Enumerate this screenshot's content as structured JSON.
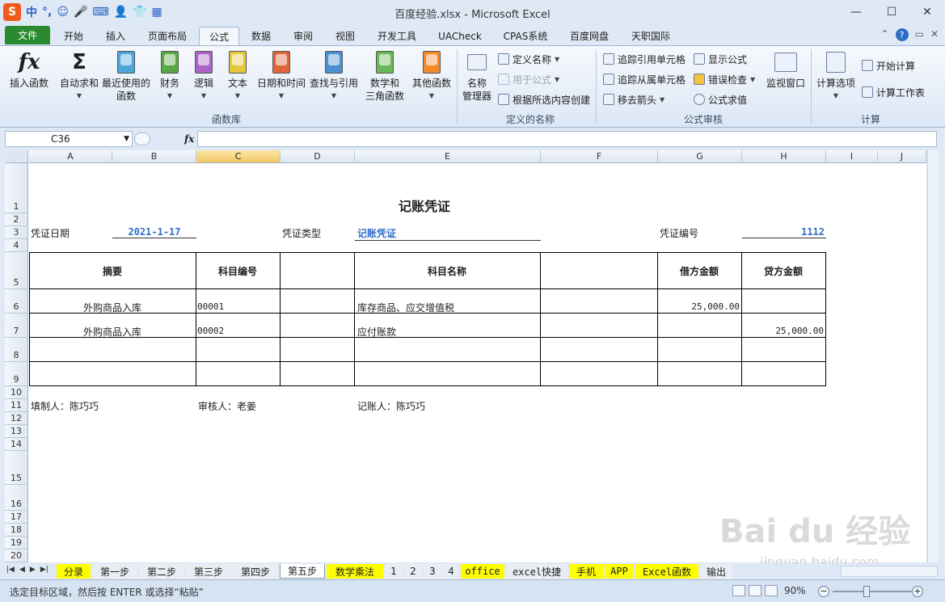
{
  "ime": {
    "logo": "S",
    "items": [
      "中",
      "°,"
    ]
  },
  "window": {
    "title": "百度经验.xlsx - Microsoft Excel",
    "minimize": "—",
    "maximize": "☐",
    "close": "✕"
  },
  "tabs": [
    "文件",
    "开始",
    "插入",
    "页面布局",
    "公式",
    "数据",
    "审阅",
    "视图",
    "开发工具",
    "UACheck",
    "CPAS系统",
    "百度网盘",
    "天职国际"
  ],
  "active_tab": "公式",
  "ribbon": {
    "function_library": {
      "label": "函数库",
      "buttons": [
        "插入函数",
        "自动求和",
        "最近使用的\n函数",
        "财务",
        "逻辑",
        "文本",
        "日期和时间",
        "查找与引用",
        "数学和\n三角函数",
        "其他函数"
      ]
    },
    "defined_names": {
      "label": "定义的名称",
      "name_manager": "名称\n管理器",
      "define_name": "定义名称",
      "use_in_formula": "用于公式",
      "create_from_selection": "根据所选内容创建"
    },
    "formula_auditing": {
      "label": "公式审核",
      "trace_precedents": "追踪引用单元格",
      "trace_dependents": "追踪从属单元格",
      "remove_arrows": "移去箭头",
      "show_formulas": "显示公式",
      "error_checking": "错误检查",
      "evaluate_formula": "公式求值",
      "watch_window": "监视窗口"
    },
    "calculation": {
      "label": "计算",
      "options": "计算选项",
      "calc_now": "开始计算",
      "calc_sheet": "计算工作表"
    }
  },
  "formula_bar": {
    "name_box": "C36",
    "fx": "fx",
    "value": ""
  },
  "columns": [
    "A",
    "B",
    "C",
    "D",
    "E",
    "F",
    "G",
    "H",
    "I",
    "J"
  ],
  "selected_column": "C",
  "rows": [
    "1",
    "2",
    "3",
    "4",
    "5",
    "6",
    "7",
    "8",
    "9",
    "10",
    "11",
    "12",
    "13",
    "14",
    "15",
    "16",
    "17",
    "18",
    "19",
    "20"
  ],
  "voucher": {
    "title": "记账凭证",
    "date_label": "凭证日期",
    "date_value": "2021-1-17",
    "type_label": "凭证类型",
    "type_value": "记账凭证",
    "number_label": "凭证编号",
    "number_value": "1112",
    "headers": {
      "summary": "摘要",
      "account_code": "科目编号",
      "account_name": "科目名称",
      "debit": "借方金额",
      "credit": "贷方金额"
    },
    "lines": [
      {
        "summary": "外购商品入库",
        "code": "00001",
        "name": "库存商品、应交增值税",
        "debit": "25,000.00",
        "credit": ""
      },
      {
        "summary": "外购商品入库",
        "code": "00002",
        "name": "应付账款",
        "debit": "",
        "credit": "25,000.00"
      }
    ],
    "preparer": "填制人：陈巧巧",
    "reviewer": "审核人：老姜",
    "bookkeeper": "记账人：陈巧巧"
  },
  "sheet_tabs": [
    {
      "label": "分录",
      "style": "yellow"
    },
    {
      "label": "第一步",
      "style": "plain"
    },
    {
      "label": "第二步",
      "style": "plain"
    },
    {
      "label": "第三步",
      "style": "plain"
    },
    {
      "label": "第四步",
      "style": "plain"
    },
    {
      "label": "第五步",
      "style": "active"
    },
    {
      "label": "数学乘法",
      "style": "yellow"
    },
    {
      "label": "1",
      "style": "plain"
    },
    {
      "label": "2",
      "style": "plain"
    },
    {
      "label": "3",
      "style": "plain"
    },
    {
      "label": "4",
      "style": "plain"
    },
    {
      "label": "office",
      "style": "yellow"
    },
    {
      "label": "excel快捷",
      "style": "plain"
    },
    {
      "label": "手机",
      "style": "yellow"
    },
    {
      "label": "APP",
      "style": "yellow"
    },
    {
      "label": "Excel函数",
      "style": "yellow"
    },
    {
      "label": "输出",
      "style": "plain"
    }
  ],
  "status": {
    "text": "选定目标区域，然后按 ENTER 或选择“粘贴”",
    "zoom": "90%"
  },
  "watermark": {
    "main": "Bai du 经验",
    "sub": "jingyan.baidu.com"
  }
}
